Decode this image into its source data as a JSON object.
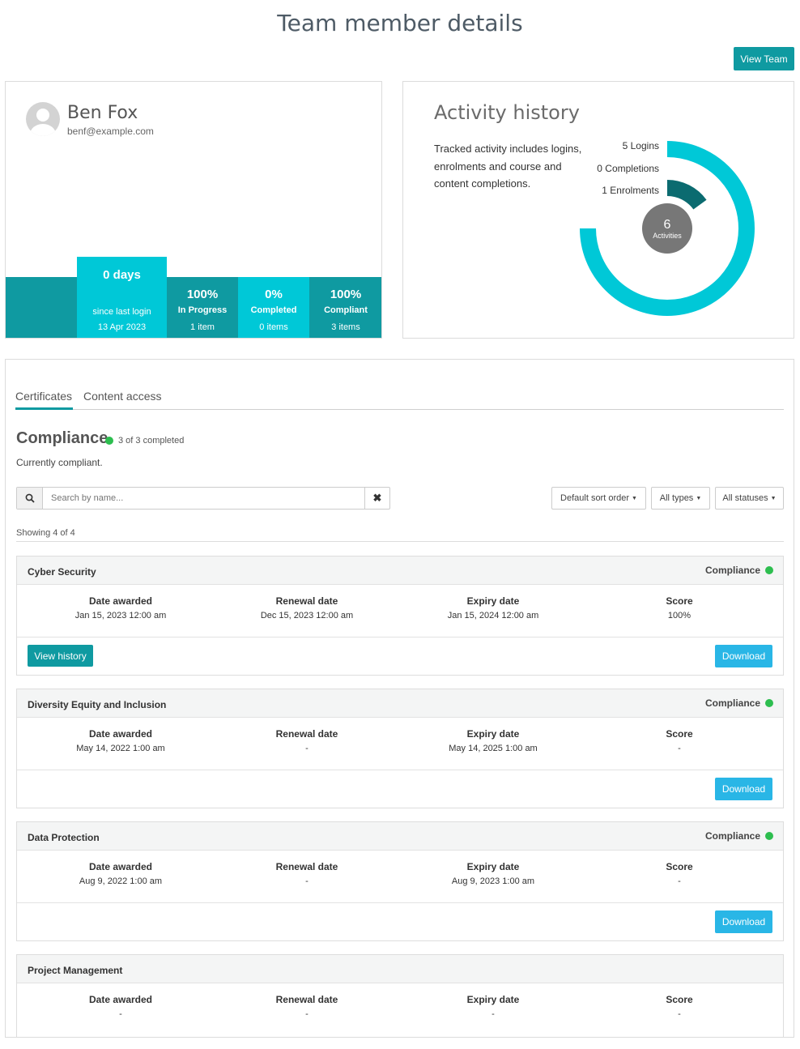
{
  "page": {
    "title": "Team member details",
    "view_team_label": "View Team"
  },
  "member": {
    "name": "Ben Fox",
    "email": "benf@example.com"
  },
  "stats": {
    "login": {
      "value": "0 days",
      "label": "since last login",
      "date": "13 Apr 2023"
    },
    "in_progress": {
      "value": "100%",
      "label": "In Progress",
      "count": "1 item"
    },
    "completed": {
      "value": "0%",
      "label": "Completed",
      "count": "0 items"
    },
    "compliant": {
      "value": "100%",
      "label": "Compliant",
      "count": "3 items"
    }
  },
  "activity": {
    "title": "Activity history",
    "description": "Tracked activity includes logins, enrolments and course and content completions.",
    "total": "6",
    "total_label": "Activities",
    "legend": [
      {
        "label": "5 Logins",
        "value": 5,
        "color": "#00c8d7"
      },
      {
        "label": "0 Completions",
        "value": 0,
        "color": "#0f9aa1"
      },
      {
        "label": "1 Enrolments",
        "value": 1,
        "color": "#0b6b70"
      }
    ]
  },
  "tabs": [
    {
      "label": "Certificates",
      "active": true
    },
    {
      "label": "Content access",
      "active": false
    }
  ],
  "compliance": {
    "title": "Compliance",
    "completed": "3 of 3 completed",
    "status_text": "Currently compliant."
  },
  "filters": {
    "search_placeholder": "Search by name...",
    "sort": "Default sort order",
    "types": "All types",
    "statuses": "All statuses"
  },
  "showing": "Showing 4 of 4",
  "field_labels": {
    "awarded": "Date awarded",
    "renewal": "Renewal date",
    "expiry": "Expiry date",
    "score": "Score"
  },
  "buttons": {
    "view_history": "View history",
    "download": "Download"
  },
  "certificates": [
    {
      "name": "Cyber Security",
      "status": "Compliance",
      "awarded": "Jan 15, 2023 12:00 am",
      "renewal": "Dec 15, 2023 12:00 am",
      "expiry": "Jan 15, 2024 12:00 am",
      "score": "100%"
    },
    {
      "name": "Diversity Equity and Inclusion",
      "status": "Compliance",
      "awarded": "May 14, 2022 1:00 am",
      "renewal": "-",
      "expiry": "May 14, 2025 1:00 am",
      "score": "-"
    },
    {
      "name": "Data Protection",
      "status": "Compliance",
      "awarded": "Aug 9, 2022 1:00 am",
      "renewal": "-",
      "expiry": "Aug 9, 2023 1:00 am",
      "score": "-"
    },
    {
      "name": "Project Management",
      "status": "",
      "awarded": "-",
      "renewal": "-",
      "expiry": "-",
      "score": "-"
    }
  ]
}
